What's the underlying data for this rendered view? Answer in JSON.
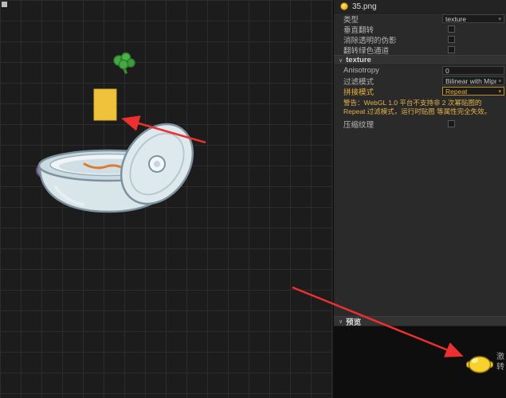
{
  "colors": {
    "accent": "#e8b33c",
    "warning": "#e2b24a",
    "arrow": "#ee2f2f"
  },
  "inspector": {
    "header": {
      "filename": "35.png"
    },
    "props": {
      "type": {
        "label": "类型",
        "value": "texture"
      },
      "flip_vertical": {
        "label": "垂直翻转",
        "checked": false
      },
      "fix_alpha": {
        "label": "消除透明的伪影",
        "checked": false
      },
      "flip_green": {
        "label": "翻转绿色通道",
        "checked": false
      }
    },
    "texture_section": {
      "caret": "∨",
      "title": "texture",
      "anisotropy": {
        "label": "Anisotropy",
        "value": "0"
      },
      "filter_mode": {
        "label": "过滤模式",
        "value": "Bilinear with Mipmaps"
      },
      "wrap_mode": {
        "label": "拼接模式",
        "value": "Repeat"
      },
      "warning": "警告：WebGL 1.0 平台不支持非 2 次幂贴图的 Repeat 过滤模式，运行时贴图 等属性完全失效。",
      "compress": {
        "label": "压缩纹理",
        "checked": false
      }
    },
    "preview_section": {
      "caret": "∨",
      "title": "预览"
    }
  },
  "edge_tab": {
    "char1": "激",
    "char2": "转"
  }
}
